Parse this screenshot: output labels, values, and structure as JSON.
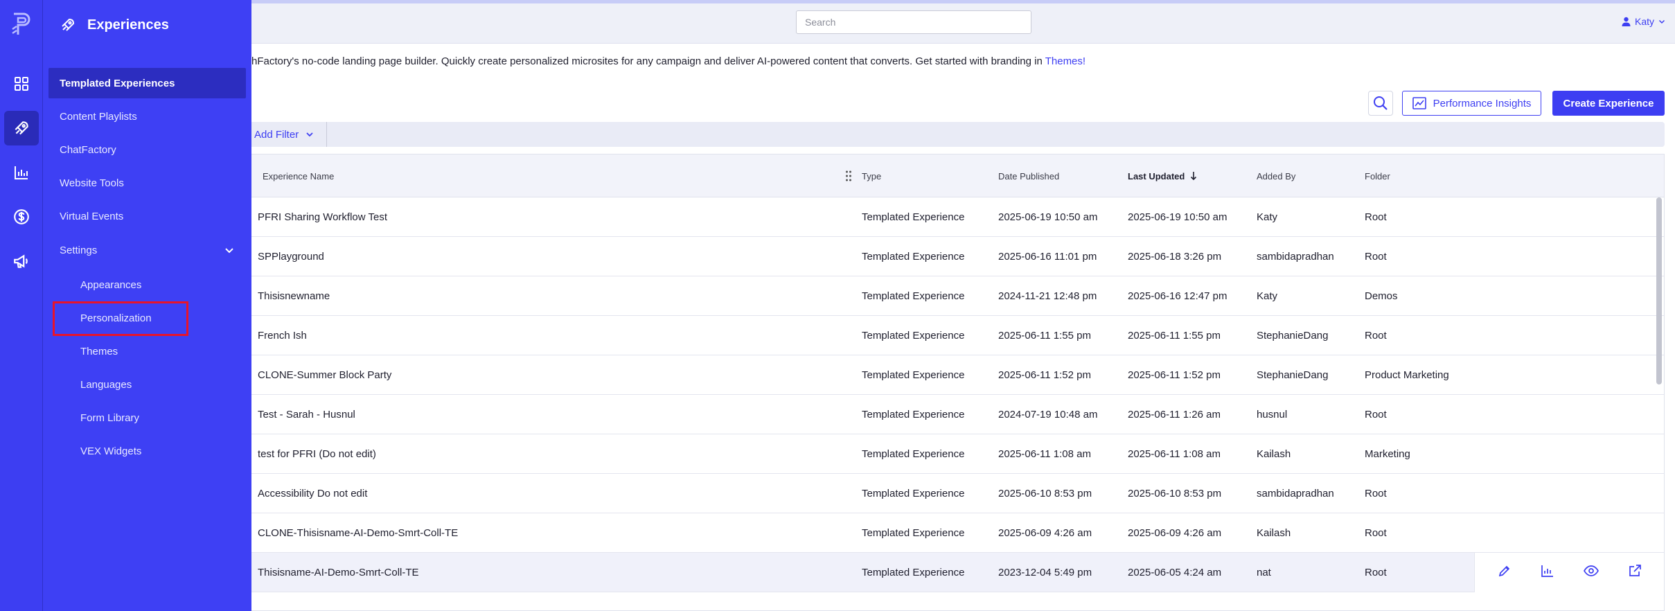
{
  "colors": {
    "brand": "#3d3ef2",
    "highlight": "#e8142a"
  },
  "sidebar": {
    "title": "Experiences",
    "items": [
      {
        "label": "Templated Experiences",
        "active": true
      },
      {
        "label": "Content Playlists"
      },
      {
        "label": "ChatFactory"
      },
      {
        "label": "Website Tools"
      },
      {
        "label": "Virtual Events"
      },
      {
        "label": "Settings",
        "expanded": true
      }
    ],
    "sub_items": [
      {
        "label": "Appearances"
      },
      {
        "label": "Personalization",
        "highlighted": true
      },
      {
        "label": "Themes"
      },
      {
        "label": "Languages"
      },
      {
        "label": "Form Library"
      },
      {
        "label": "VEX Widgets"
      }
    ],
    "rail_icons": [
      "dashboard-icon",
      "rocket-icon",
      "analytics-icon",
      "dollar-icon",
      "megaphone-icon"
    ]
  },
  "topbar": {
    "search_placeholder": "Search",
    "user_name": "Katy"
  },
  "description": {
    "text": "hFactory's no-code landing page builder. Quickly create personalized microsites for any campaign and deliver AI-powered content that converts. Get started with branding in ",
    "link": "Themes!"
  },
  "actions": {
    "performance_label": "Performance Insights",
    "create_label": "Create Experience",
    "add_filter_label": "Add Filter"
  },
  "table": {
    "columns": [
      "Experience Name",
      "Type",
      "Date Published",
      "Last Updated",
      "Added By",
      "Folder"
    ],
    "sorted_column": "Last Updated",
    "sort_direction": "descending",
    "rows": [
      {
        "name": "PFRI Sharing Workflow Test",
        "type": "Templated Experience",
        "published": "2025-06-19 10:50 am",
        "updated": "2025-06-19 10:50 am",
        "added_by": "Katy",
        "folder": "Root"
      },
      {
        "name": "SPPlayground",
        "type": "Templated Experience",
        "published": "2025-06-16 11:01 pm",
        "updated": "2025-06-18 3:26 pm",
        "added_by": "sambidapradhan",
        "folder": "Root"
      },
      {
        "name": "Thisisnewname",
        "type": "Templated Experience",
        "published": "2024-11-21 12:48 pm",
        "updated": "2025-06-16 12:47 pm",
        "added_by": "Katy",
        "folder": "Demos"
      },
      {
        "name": "French Ish",
        "type": "Templated Experience",
        "published": "2025-06-11 1:55 pm",
        "updated": "2025-06-11 1:55 pm",
        "added_by": "StephanieDang",
        "folder": "Root"
      },
      {
        "name": "CLONE-Summer Block Party",
        "type": "Templated Experience",
        "published": "2025-06-11 1:52 pm",
        "updated": "2025-06-11 1:52 pm",
        "added_by": "StephanieDang",
        "folder": "Product Marketing"
      },
      {
        "name": "Test - Sarah - Husnul",
        "type": "Templated Experience",
        "published": "2024-07-19 10:48 am",
        "updated": "2025-06-11 1:26 am",
        "added_by": "husnul",
        "folder": "Root"
      },
      {
        "name": "test for PFRI (Do not edit)",
        "type": "Templated Experience",
        "published": "2025-06-11 1:08 am",
        "updated": "2025-06-11 1:08 am",
        "added_by": "Kailash",
        "folder": "Marketing"
      },
      {
        "name": "Accessibility Do not edit",
        "type": "Templated Experience",
        "published": "2025-06-10 8:53 pm",
        "updated": "2025-06-10 8:53 pm",
        "added_by": "sambidapradhan",
        "folder": "Root"
      },
      {
        "name": "CLONE-Thisisname-AI-Demo-Smrt-Coll-TE",
        "type": "Templated Experience",
        "published": "2025-06-09 4:26 am",
        "updated": "2025-06-09 4:26 am",
        "added_by": "Kailash",
        "folder": "Root"
      },
      {
        "name": "Thisisname-AI-Demo-Smrt-Coll-TE",
        "type": "Templated Experience",
        "published": "2023-12-04 5:49 pm",
        "updated": "2025-06-05 4:24 am",
        "added_by": "nat",
        "folder": "Root",
        "hovered": true
      }
    ],
    "row_action_icons": [
      "edit-icon",
      "analytics-icon",
      "preview-icon",
      "share-icon"
    ]
  }
}
